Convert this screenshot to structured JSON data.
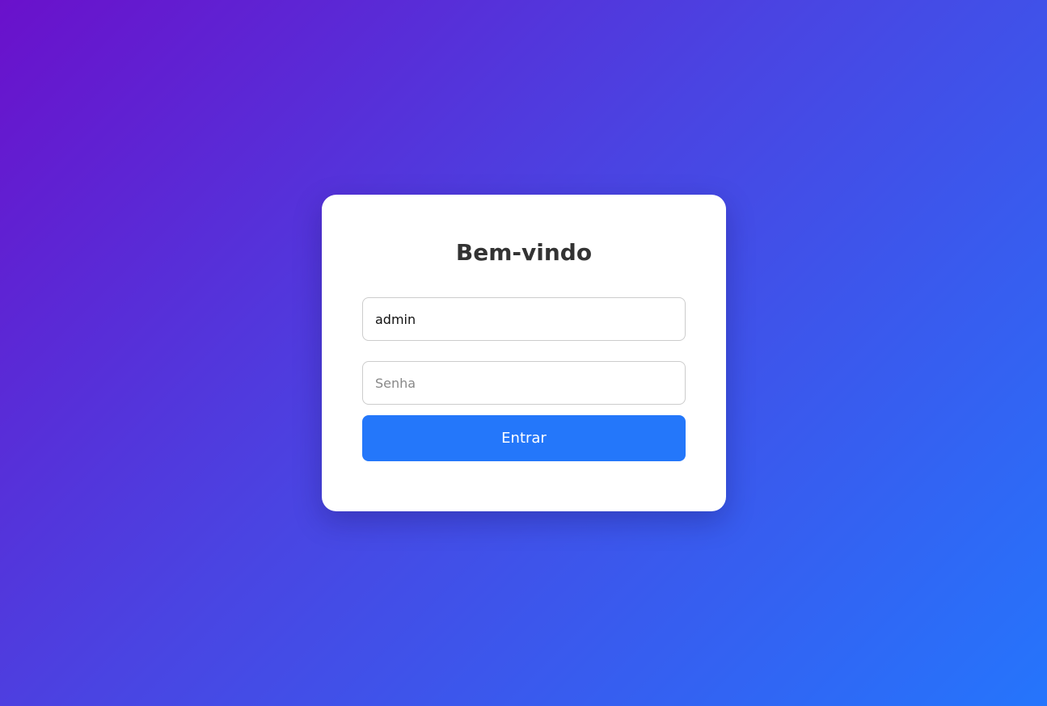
{
  "login": {
    "title": "Bem-vindo",
    "username": {
      "value": "admin",
      "placeholder": ""
    },
    "password": {
      "value": "",
      "placeholder": "Senha"
    },
    "submit_label": "Entrar"
  },
  "colors": {
    "background_gradient_start": "#6a11cb",
    "background_gradient_end": "#2575fc",
    "card_background": "#ffffff",
    "title_color": "#333333",
    "button_color": "#2477fa",
    "button_text": "#ffffff"
  }
}
